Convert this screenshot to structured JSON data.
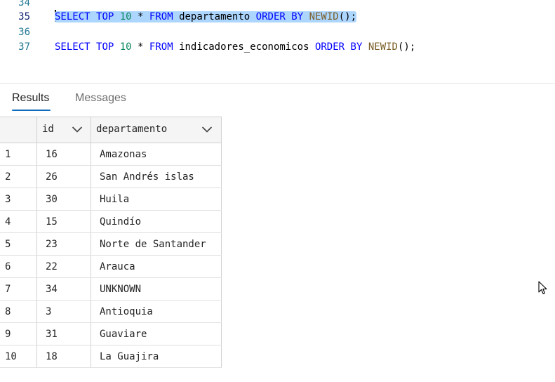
{
  "editor": {
    "lines": [
      {
        "num": "34"
      },
      {
        "num": "35",
        "tokens": {
          "select": "SELECT",
          "top": "TOP",
          "n": "10",
          "star": "*",
          "from": "FROM",
          "table": "departamento",
          "order": "ORDER",
          "by": "BY",
          "fn": "NEWID",
          "tail": "();"
        }
      },
      {
        "num": "36"
      },
      {
        "num": "37",
        "tokens": {
          "select": "SELECT",
          "top": "TOP",
          "n": "10",
          "star": "*",
          "from": "FROM",
          "table": "indicadores_economicos",
          "order": "ORDER",
          "by": "BY",
          "fn": "NEWID",
          "tail": "();"
        }
      }
    ]
  },
  "tabs": {
    "results": "Results",
    "messages": "Messages",
    "active": "results"
  },
  "grid": {
    "columns": [
      "id",
      "departamento"
    ],
    "rows": [
      {
        "n": "1",
        "id": "16",
        "dep": "Amazonas"
      },
      {
        "n": "2",
        "id": "26",
        "dep": "San Andrés islas"
      },
      {
        "n": "3",
        "id": "30",
        "dep": "Huila"
      },
      {
        "n": "4",
        "id": "15",
        "dep": "Quindío"
      },
      {
        "n": "5",
        "id": "23",
        "dep": "Norte de Santander"
      },
      {
        "n": "6",
        "id": "22",
        "dep": "Arauca"
      },
      {
        "n": "7",
        "id": "34",
        "dep": "UNKNOWN"
      },
      {
        "n": "8",
        "id": "3",
        "dep": "Antioquia"
      },
      {
        "n": "9",
        "id": "31",
        "dep": "Guaviare"
      },
      {
        "n": "10",
        "id": "18",
        "dep": "La Guajira"
      }
    ]
  },
  "colors": {
    "keyword": "#0000ff",
    "number": "#098658",
    "function": "#795e26",
    "selection": "#add6ff",
    "accent": "#0f6cbd"
  }
}
